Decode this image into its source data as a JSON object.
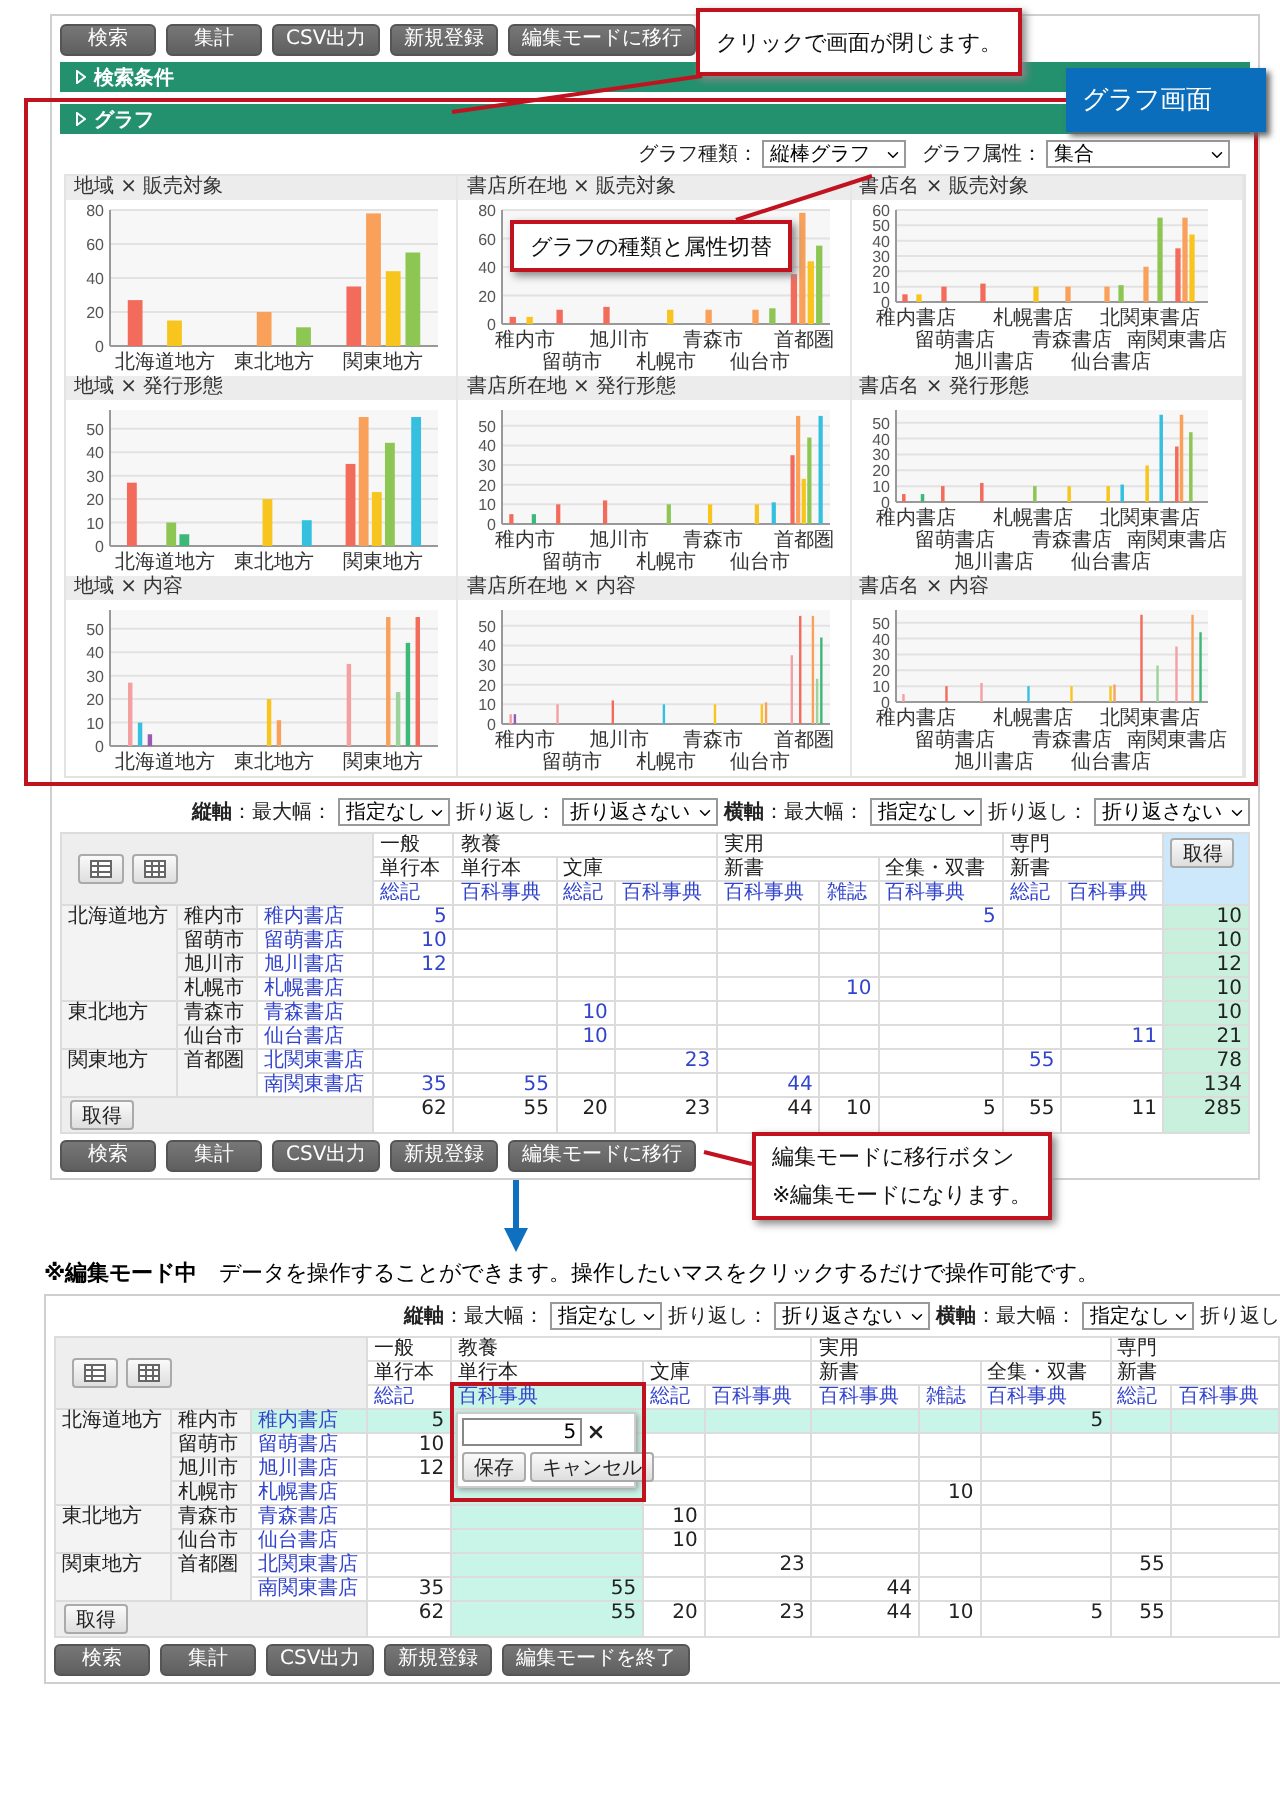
{
  "toolbar": {
    "buttons": [
      "検索",
      "集計",
      "CSV出力",
      "新規登録",
      "編集モードに移行"
    ]
  },
  "sections": [
    {
      "label": "検索条件"
    },
    {
      "label": "グラフ"
    }
  ],
  "graph_controls": [
    {
      "label": "グラフ種類：",
      "value": "縦棒グラフ"
    },
    {
      "label": "グラフ属性：",
      "value": "集合"
    }
  ],
  "charts": [
    {
      "title": "地域 × 販売対象",
      "chart_data": {
        "type": "bar",
        "grid": true,
        "categories": [
          "北海道地方",
          "東北地方",
          "関東地方"
        ],
        "ylim": [
          0,
          80
        ],
        "yticks": [
          0,
          20,
          40,
          60,
          80
        ],
        "series": [
          {
            "color": "#f26b5b",
            "values": [
              27,
              null,
              35
            ]
          },
          {
            "color": "#f9a15a",
            "values": [
              null,
              20,
              78
            ]
          },
          {
            "color": "#f7c51e",
            "values": [
              15,
              null,
              44
            ]
          },
          {
            "color": "#8dc653",
            "values": [
              null,
              11,
              55
            ]
          }
        ]
      }
    },
    {
      "title": "書店所在地 × 販売対象",
      "chart_data": {
        "type": "bar",
        "grid": true,
        "categories": [
          "稚内市",
          "留萌市",
          "旭川市",
          "札幌市",
          "青森市",
          "仙台市",
          "首都圏"
        ],
        "ylim": [
          0,
          80
        ],
        "yticks": [
          0,
          20,
          40,
          60,
          80
        ],
        "series": [
          {
            "color": "#f26b5b",
            "values": [
              5,
              10,
              12,
              null,
              null,
              null,
              35
            ]
          },
          {
            "color": "#f9a15a",
            "values": [
              null,
              null,
              null,
              null,
              10,
              10,
              78
            ]
          },
          {
            "color": "#f7c51e",
            "values": [
              5,
              null,
              null,
              10,
              null,
              null,
              44
            ]
          },
          {
            "color": "#8dc653",
            "values": [
              null,
              null,
              null,
              null,
              null,
              11,
              55
            ]
          }
        ]
      }
    },
    {
      "title": "書店名 × 販売対象",
      "chart_data": {
        "type": "bar",
        "grid": true,
        "categories": [
          "稚内書店",
          "留萌書店",
          "旭川書店",
          "札幌書店",
          "青森書店",
          "仙台書店",
          "北関東書店",
          "南関東書店"
        ],
        "ylim": [
          0,
          60
        ],
        "yticks": [
          0,
          10,
          20,
          30,
          40,
          50,
          60
        ],
        "series": [
          {
            "color": "#f26b5b",
            "values": [
              5,
              10,
              12,
              null,
              null,
              null,
              null,
              35
            ]
          },
          {
            "color": "#f9a15a",
            "values": [
              null,
              null,
              null,
              null,
              10,
              10,
              23,
              55
            ]
          },
          {
            "color": "#f7c51e",
            "values": [
              5,
              null,
              null,
              10,
              null,
              null,
              null,
              44
            ]
          },
          {
            "color": "#8dc653",
            "values": [
              null,
              null,
              null,
              null,
              null,
              11,
              55,
              null
            ]
          }
        ]
      }
    },
    {
      "title": "地域 × 発行形態",
      "chart_data": {
        "type": "bar",
        "grid": true,
        "categories": [
          "北海道地方",
          "東北地方",
          "関東地方"
        ],
        "ylim": [
          0,
          58
        ],
        "yticks": [
          0,
          10,
          20,
          30,
          40,
          50
        ],
        "series": [
          {
            "color": "#f26b5b",
            "values": [
              27,
              null,
              35
            ]
          },
          {
            "color": "#f9a15a",
            "values": [
              null,
              null,
              55
            ]
          },
          {
            "color": "#f7c51e",
            "values": [
              null,
              20,
              23
            ]
          },
          {
            "color": "#8dc653",
            "values": [
              10,
              null,
              44
            ]
          },
          {
            "color": "#3cb878",
            "values": [
              5,
              null,
              null
            ]
          },
          {
            "color": "#35c0e0",
            "values": [
              null,
              11,
              55
            ]
          }
        ]
      }
    },
    {
      "title": "書店所在地 × 発行形態",
      "chart_data": {
        "type": "bar",
        "grid": true,
        "categories": [
          "稚内市",
          "留萌市",
          "旭川市",
          "札幌市",
          "青森市",
          "仙台市",
          "首都圏"
        ],
        "ylim": [
          0,
          58
        ],
        "yticks": [
          0,
          10,
          20,
          30,
          40,
          50
        ],
        "series": [
          {
            "color": "#f26b5b",
            "values": [
              5,
              10,
              12,
              null,
              null,
              null,
              35
            ]
          },
          {
            "color": "#f9a15a",
            "values": [
              null,
              null,
              null,
              null,
              null,
              null,
              55
            ]
          },
          {
            "color": "#f7c51e",
            "values": [
              null,
              null,
              null,
              null,
              10,
              10,
              23
            ]
          },
          {
            "color": "#8dc653",
            "values": [
              null,
              null,
              null,
              10,
              null,
              null,
              44
            ]
          },
          {
            "color": "#3cb878",
            "values": [
              5,
              null,
              null,
              null,
              null,
              null,
              null
            ]
          },
          {
            "color": "#35c0e0",
            "values": [
              null,
              null,
              null,
              null,
              null,
              11,
              55
            ]
          }
        ]
      }
    },
    {
      "title": "書店名 × 発行形態",
      "chart_data": {
        "type": "bar",
        "grid": true,
        "categories": [
          "稚内書店",
          "留萌書店",
          "旭川書店",
          "札幌書店",
          "青森書店",
          "仙台書店",
          "北関東書店",
          "南関東書店"
        ],
        "ylim": [
          0,
          58
        ],
        "yticks": [
          0,
          10,
          20,
          30,
          40,
          50
        ],
        "series": [
          {
            "color": "#f26b5b",
            "values": [
              5,
              10,
              12,
              null,
              null,
              null,
              null,
              35
            ]
          },
          {
            "color": "#f9a15a",
            "values": [
              null,
              null,
              null,
              null,
              null,
              null,
              null,
              55
            ]
          },
          {
            "color": "#f7c51e",
            "values": [
              null,
              null,
              null,
              null,
              10,
              10,
              23,
              null
            ]
          },
          {
            "color": "#8dc653",
            "values": [
              null,
              null,
              null,
              10,
              null,
              null,
              null,
              44
            ]
          },
          {
            "color": "#3cb878",
            "values": [
              5,
              null,
              null,
              null,
              null,
              null,
              null,
              null
            ]
          },
          {
            "color": "#35c0e0",
            "values": [
              null,
              null,
              null,
              null,
              null,
              11,
              55,
              null
            ]
          }
        ]
      }
    },
    {
      "title": "地域 × 内容",
      "chart_data": {
        "type": "bar",
        "grid": true,
        "categories": [
          "北海道地方",
          "東北地方",
          "関東地方"
        ],
        "ylim": [
          0,
          58
        ],
        "yticks": [
          0,
          10,
          20,
          30,
          40,
          50
        ],
        "series": [
          {
            "color": "#f4a0a0",
            "values": [
              27,
              null,
              35
            ]
          },
          {
            "color": "#35c0e0",
            "values": [
              10,
              null,
              null
            ]
          },
          {
            "color": "#9b59b6",
            "values": [
              5,
              null,
              null
            ]
          },
          {
            "color": "#f7c51e",
            "values": [
              null,
              20,
              null
            ]
          },
          {
            "color": "#f9a15a",
            "values": [
              null,
              11,
              55
            ]
          },
          {
            "color": "#9bd39b",
            "values": [
              null,
              null,
              23
            ]
          },
          {
            "color": "#3cb878",
            "values": [
              null,
              null,
              44
            ]
          },
          {
            "color": "#f26b5b",
            "values": [
              null,
              null,
              55
            ]
          }
        ]
      }
    },
    {
      "title": "書店所在地 × 内容",
      "chart_data": {
        "type": "bar",
        "grid": true,
        "categories": [
          "稚内市",
          "留萌市",
          "旭川市",
          "札幌市",
          "青森市",
          "仙台市",
          "首都圏"
        ],
        "ylim": [
          0,
          58
        ],
        "yticks": [
          0,
          10,
          20,
          30,
          40,
          50
        ],
        "series": [
          {
            "color": "#f4a0a0",
            "values": [
              5,
              10,
              null,
              null,
              null,
              null,
              35
            ]
          },
          {
            "color": "#9b59b6",
            "values": [
              5,
              null,
              null,
              null,
              null,
              null,
              null
            ]
          },
          {
            "color": "#f26b5b",
            "values": [
              null,
              null,
              12,
              null,
              null,
              null,
              55
            ]
          },
          {
            "color": "#35c0e0",
            "values": [
              null,
              null,
              null,
              10,
              null,
              null,
              null
            ]
          },
          {
            "color": "#f7c51e",
            "values": [
              null,
              null,
              null,
              null,
              10,
              10,
              null
            ]
          },
          {
            "color": "#f9a15a",
            "values": [
              null,
              null,
              null,
              null,
              null,
              11,
              55
            ]
          },
          {
            "color": "#9bd39b",
            "values": [
              null,
              null,
              null,
              null,
              null,
              null,
              23
            ]
          },
          {
            "color": "#3cb878",
            "values": [
              null,
              null,
              null,
              null,
              null,
              null,
              44
            ]
          }
        ]
      }
    },
    {
      "title": "書店名 × 内容",
      "chart_data": {
        "type": "bar",
        "grid": true,
        "categories": [
          "稚内書店",
          "留萌書店",
          "旭川書店",
          "札幌書店",
          "青森書店",
          "仙台書店",
          "北関東書店",
          "南関東書店"
        ],
        "ylim": [
          0,
          58
        ],
        "yticks": [
          0,
          10,
          20,
          30,
          40,
          50
        ],
        "series": [
          {
            "color": "#f4a0a0",
            "values": [
              5,
              null,
              12,
              null,
              null,
              null,
              null,
              35
            ]
          },
          {
            "color": "#f26b5b",
            "values": [
              null,
              10,
              null,
              null,
              null,
              null,
              55,
              null
            ]
          },
          {
            "color": "#35c0e0",
            "values": [
              null,
              null,
              null,
              10,
              null,
              null,
              null,
              null
            ]
          },
          {
            "color": "#f7c51e",
            "values": [
              null,
              null,
              null,
              null,
              10,
              10,
              null,
              null
            ]
          },
          {
            "color": "#f9a15a",
            "values": [
              null,
              null,
              null,
              null,
              null,
              11,
              null,
              55
            ]
          },
          {
            "color": "#9bd39b",
            "values": [
              null,
              null,
              null,
              null,
              null,
              null,
              23,
              null
            ]
          },
          {
            "color": "#3cb878",
            "values": [
              null,
              null,
              null,
              null,
              null,
              null,
              null,
              44
            ]
          }
        ]
      }
    }
  ],
  "view_table": {
    "axis_options": [
      {
        "label": "**縦軸**：最大幅：",
        "value": "指定なし"
      },
      {
        "label": "折り返し：",
        "value": "折り返さない"
      },
      {
        "label": "**横軸**：最大幅：",
        "value": "指定なし"
      },
      {
        "label": "折り返し：",
        "value": "折り返さない"
      }
    ],
    "groups": [
      {
        "label": "一般",
        "subgroups": [
          {
            "label": "単行本",
            "columns": [
              {
                "label": "総記",
                "selected": false
              }
            ]
          }
        ]
      },
      {
        "label": "教養",
        "subgroups": [
          {
            "label": "単行本",
            "columns": [
              {
                "label": "百科事典",
                "selected": false
              }
            ]
          },
          {
            "label": "文庫",
            "columns": [
              {
                "label": "総記",
                "selected": false
              },
              {
                "label": "百科事典",
                "selected": false
              }
            ]
          }
        ]
      },
      {
        "label": "実用",
        "subgroups": [
          {
            "label": "新書",
            "columns": [
              {
                "label": "百科事典",
                "selected": false
              },
              {
                "label": "雑誌",
                "selected": false
              }
            ]
          },
          {
            "label": "全集・双書",
            "columns": [
              {
                "label": "百科事典",
                "selected": false
              }
            ]
          }
        ]
      },
      {
        "label": "専門",
        "subgroups": [
          {
            "label": "新書",
            "columns": [
              {
                "label": "総記",
                "selected": false
              },
              {
                "label": "百科事典",
                "selected": false
              }
            ]
          }
        ]
      }
    ],
    "get_button": "取得",
    "rows": [
      {
        "region": "北海道地方",
        "city": "稚内市",
        "store": "稚内書店",
        "selected": false,
        "cells": [
          "5",
          null,
          null,
          null,
          null,
          null,
          "5",
          null,
          null
        ],
        "total": "10"
      },
      {
        "city": "留萌市",
        "store": "留萌書店",
        "selected": false,
        "cells": [
          "10",
          null,
          null,
          null,
          null,
          null,
          null,
          null,
          null
        ],
        "total": "10"
      },
      {
        "city": "旭川市",
        "store": "旭川書店",
        "selected": false,
        "cells": [
          "12",
          null,
          null,
          null,
          null,
          null,
          null,
          null,
          null
        ],
        "total": "12"
      },
      {
        "city": "札幌市",
        "store": "札幌書店",
        "selected": false,
        "cells": [
          null,
          null,
          null,
          null,
          null,
          "10",
          null,
          null,
          null
        ],
        "total": "10"
      },
      {
        "region": "東北地方",
        "city": "青森市",
        "store": "青森書店",
        "selected": false,
        "cells": [
          null,
          null,
          "10",
          null,
          null,
          null,
          null,
          null,
          null
        ],
        "total": "10"
      },
      {
        "city": "仙台市",
        "store": "仙台書店",
        "selected": false,
        "cells": [
          null,
          null,
          "10",
          null,
          null,
          null,
          null,
          null,
          "11"
        ],
        "total": "21"
      },
      {
        "region": "関東地方",
        "city": "首都圏",
        "store": "北関東書店",
        "selected": false,
        "cells": [
          null,
          null,
          null,
          "23",
          null,
          null,
          null,
          "55",
          null
        ],
        "total": "78"
      },
      {
        "store": "南関東書店",
        "selected": false,
        "cells": [
          "35",
          "55",
          null,
          null,
          "44",
          null,
          null,
          null,
          null
        ],
        "total": "134"
      }
    ],
    "footer_button": "取得",
    "totals": [
      "62",
      "55",
      "20",
      "23",
      "44",
      "10",
      "5",
      "55",
      "11"
    ],
    "grand_total": "285",
    "buttons": [
      "検索",
      "集計",
      "CSV出力",
      "新規登録",
      "編集モードに移行"
    ]
  },
  "annotations": [
    {
      "kind": "note",
      "lines": [
        "クリックで画面が閉じます。"
      ]
    },
    {
      "kind": "label",
      "lines": [
        "グラフ画面"
      ]
    },
    {
      "kind": "note",
      "lines": [
        "グラフの種類と属性切替"
      ]
    },
    {
      "kind": "note",
      "lines": [
        "編集モードに移行ボタン",
        "※編集モードになります。"
      ]
    }
  ],
  "edit_note": "**※編集モード中**　データを操作することができます。操作したいマスをクリックするだけで操作可能です。",
  "edit_table": {
    "axis_options": [
      {
        "label": "**縦軸**：最大幅：",
        "value": "指定なし"
      },
      {
        "label": "折り返し：",
        "value": "折り返さない"
      },
      {
        "label": "**横軸**：最大幅：",
        "value": "指定なし"
      },
      {
        "label": "折り返し"
      }
    ],
    "groups": [
      {
        "label": "一般",
        "subgroups": [
          {
            "label": "単行本",
            "columns": [
              {
                "label": "総記",
                "selected": false
              }
            ]
          }
        ]
      },
      {
        "label": "教養",
        "subgroups": [
          {
            "label": "単行本",
            "columns": [
              {
                "label": "百科事典",
                "selected": true
              }
            ]
          },
          {
            "label": "文庫",
            "columns": [
              {
                "label": "総記",
                "selected": false
              },
              {
                "label": "百科事典",
                "selected": false
              }
            ]
          }
        ]
      },
      {
        "label": "実用",
        "subgroups": [
          {
            "label": "新書",
            "columns": [
              {
                "label": "百科事典",
                "selected": false
              },
              {
                "label": "雑誌",
                "selected": false
              }
            ]
          },
          {
            "label": "全集・双書",
            "columns": [
              {
                "label": "百科事典",
                "selected": false
              }
            ]
          }
        ]
      },
      {
        "label": "専門",
        "subgroups": [
          {
            "label": "新書",
            "columns": [
              {
                "label": "総記",
                "selected": false
              },
              {
                "label": "百科事典",
                "selected": false
              }
            ]
          }
        ]
      }
    ],
    "rows": [
      {
        "region": "北海道地方",
        "city": "稚内市",
        "store": "稚内書店",
        "selected": true,
        "cells": [
          "5",
          null,
          null,
          null,
          null,
          null,
          "5",
          null,
          null
        ]
      },
      {
        "city": "留萌市",
        "store": "留萌書店",
        "selected": false,
        "cells": [
          "10",
          null,
          null,
          null,
          null,
          null,
          null,
          null,
          null
        ]
      },
      {
        "city": "旭川市",
        "store": "旭川書店",
        "selected": false,
        "cells": [
          "12",
          null,
          null,
          null,
          null,
          null,
          null,
          null,
          null
        ]
      },
      {
        "city": "札幌市",
        "store": "札幌書店",
        "selected": false,
        "cells": [
          null,
          null,
          null,
          null,
          null,
          "10",
          null,
          null,
          null
        ]
      },
      {
        "region": "東北地方",
        "city": "青森市",
        "store": "青森書店",
        "selected": false,
        "cells": [
          null,
          null,
          "10",
          null,
          null,
          null,
          null,
          null,
          null
        ]
      },
      {
        "city": "仙台市",
        "store": "仙台書店",
        "selected": false,
        "cells": [
          null,
          null,
          "10",
          null,
          null,
          null,
          null,
          null,
          null
        ]
      },
      {
        "region": "関東地方",
        "city": "首都圏",
        "store": "北関東書店",
        "selected": false,
        "cells": [
          null,
          null,
          null,
          "23",
          null,
          null,
          null,
          "55",
          null
        ]
      },
      {
        "store": "南関東書店",
        "selected": false,
        "cells": [
          "35",
          "55",
          null,
          null,
          "44",
          null,
          null,
          null,
          null
        ]
      }
    ],
    "editor": {
      "value": "5",
      "buttons": [
        "保存",
        "キャンセル"
      ]
    },
    "footer_button": "取得",
    "totals": [
      "62",
      "55",
      "20",
      "23",
      "44",
      "10",
      "5",
      "55"
    ],
    "buttons": [
      "検索",
      "集計",
      "CSV出力",
      "新規登録",
      "編集モードを終了"
    ]
  }
}
